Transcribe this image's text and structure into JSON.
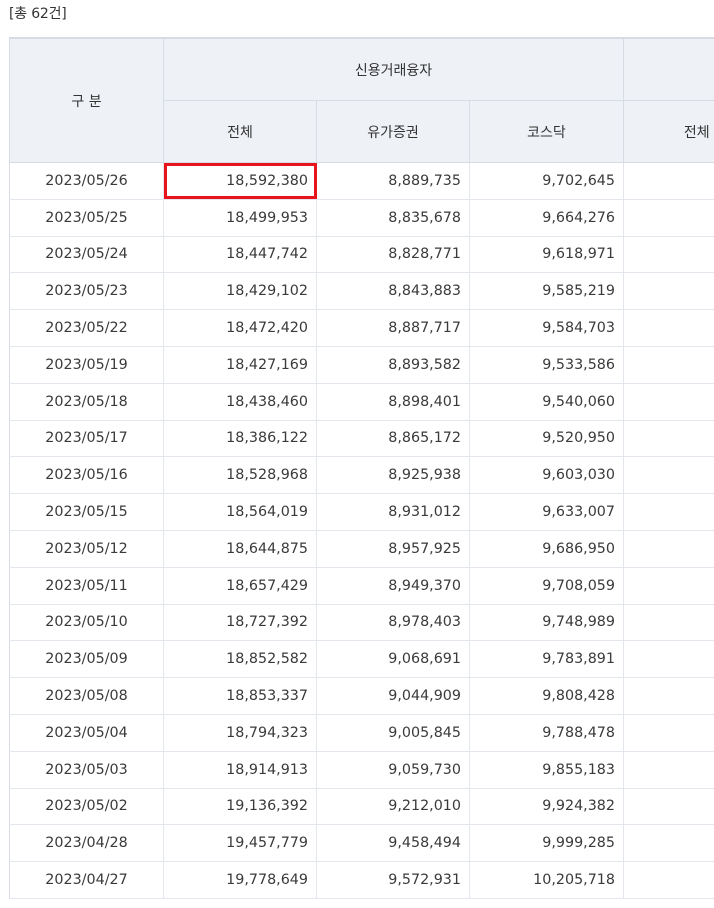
{
  "count_label": "[총 62건]",
  "header": {
    "category": "구 분",
    "group1": "신용거래융자",
    "sub": [
      "전체",
      "유가증권",
      "코스닥",
      "전체"
    ]
  },
  "rows": [
    {
      "date": "2023/05/26",
      "total": "18,592,380",
      "kospi": "8,889,735",
      "kosdaq": "9,702,645"
    },
    {
      "date": "2023/05/25",
      "total": "18,499,953",
      "kospi": "8,835,678",
      "kosdaq": "9,664,276"
    },
    {
      "date": "2023/05/24",
      "total": "18,447,742",
      "kospi": "8,828,771",
      "kosdaq": "9,618,971"
    },
    {
      "date": "2023/05/23",
      "total": "18,429,102",
      "kospi": "8,843,883",
      "kosdaq": "9,585,219"
    },
    {
      "date": "2023/05/22",
      "total": "18,472,420",
      "kospi": "8,887,717",
      "kosdaq": "9,584,703"
    },
    {
      "date": "2023/05/19",
      "total": "18,427,169",
      "kospi": "8,893,582",
      "kosdaq": "9,533,586"
    },
    {
      "date": "2023/05/18",
      "total": "18,438,460",
      "kospi": "8,898,401",
      "kosdaq": "9,540,060"
    },
    {
      "date": "2023/05/17",
      "total": "18,386,122",
      "kospi": "8,865,172",
      "kosdaq": "9,520,950"
    },
    {
      "date": "2023/05/16",
      "total": "18,528,968",
      "kospi": "8,925,938",
      "kosdaq": "9,603,030"
    },
    {
      "date": "2023/05/15",
      "total": "18,564,019",
      "kospi": "8,931,012",
      "kosdaq": "9,633,007"
    },
    {
      "date": "2023/05/12",
      "total": "18,644,875",
      "kospi": "8,957,925",
      "kosdaq": "9,686,950"
    },
    {
      "date": "2023/05/11",
      "total": "18,657,429",
      "kospi": "8,949,370",
      "kosdaq": "9,708,059"
    },
    {
      "date": "2023/05/10",
      "total": "18,727,392",
      "kospi": "8,978,403",
      "kosdaq": "9,748,989"
    },
    {
      "date": "2023/05/09",
      "total": "18,852,582",
      "kospi": "9,068,691",
      "kosdaq": "9,783,891"
    },
    {
      "date": "2023/05/08",
      "total": "18,853,337",
      "kospi": "9,044,909",
      "kosdaq": "9,808,428"
    },
    {
      "date": "2023/05/04",
      "total": "18,794,323",
      "kospi": "9,005,845",
      "kosdaq": "9,788,478"
    },
    {
      "date": "2023/05/03",
      "total": "18,914,913",
      "kospi": "9,059,730",
      "kosdaq": "9,855,183"
    },
    {
      "date": "2023/05/02",
      "total": "19,136,392",
      "kospi": "9,212,010",
      "kosdaq": "9,924,382"
    },
    {
      "date": "2023/04/28",
      "total": "19,457,779",
      "kospi": "9,458,494",
      "kosdaq": "9,999,285"
    },
    {
      "date": "2023/04/27",
      "total": "19,778,649",
      "kospi": "9,572,931",
      "kosdaq": "10,205,718"
    }
  ],
  "highlight": {
    "row": 0,
    "column": "total",
    "color": "#e8141b"
  }
}
